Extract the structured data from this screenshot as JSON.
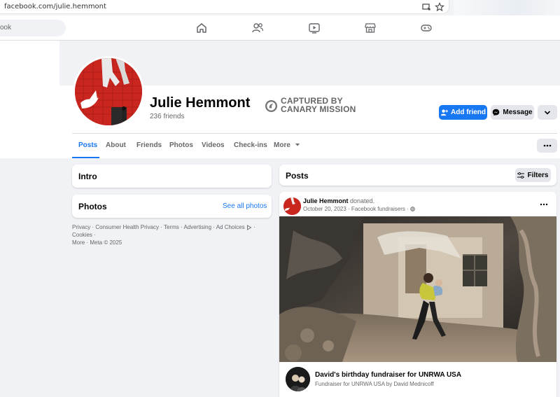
{
  "browser": {
    "url": "facebook.com/julie.hemmont"
  },
  "nav": {
    "search_placeholder": "ook"
  },
  "profile": {
    "name": "Julie Hemmont",
    "friends": "236 friends",
    "captured_line1": "CAPTURED BY",
    "captured_line2": "CANARY MISSION",
    "add_friend_label": "Add friend",
    "message_label": "Message"
  },
  "tabs": [
    {
      "label": "Posts"
    },
    {
      "label": "About"
    },
    {
      "label": "Friends"
    },
    {
      "label": "Photos"
    },
    {
      "label": "Videos"
    },
    {
      "label": "Check-ins"
    },
    {
      "label": "More"
    }
  ],
  "intro": {
    "title": "Intro"
  },
  "photos": {
    "title": "Photos",
    "see_all": "See all photos"
  },
  "footer": {
    "line1": "Privacy · Consumer Health Privacy · Terms · Advertising · Ad Choices",
    "line1b": "· Cookies ·",
    "line2": "More · Meta © 2025"
  },
  "posts": {
    "title": "Posts",
    "filters_label": "Filters"
  },
  "post": {
    "author": "Julie Hemmont",
    "action": "donated.",
    "meta": "October 20, 2023 · Facebook fundraisers ·",
    "fundraiser_title": "David's birthday fundraiser for UNRWA USA",
    "fundraiser_sub": "Fundraiser for UNRWA USA by David Mednicoff"
  },
  "colors": {
    "accent": "#1877f2",
    "page_bg": "#f0f2f5"
  }
}
